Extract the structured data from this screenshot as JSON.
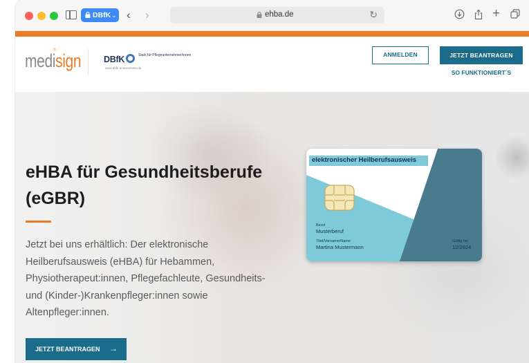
{
  "browser": {
    "tab_label": "DBfK",
    "url": "ehba.de"
  },
  "colors": {
    "accent": "#ec7b25",
    "primary": "#1b6c8a",
    "card_light": "#7ecad9",
    "card_dark": "#487b8e"
  },
  "header": {
    "logo_medisign_a": "medi",
    "logo_medisign_b": "sign",
    "logo_reg": "®",
    "dbfk_name": "DBfK",
    "dbfk_tagline": "Stark für Pflegeunternehmer/innen",
    "dbfk_url": "www.dbfk-unternehmer.de",
    "login_label": "ANMELDEN",
    "apply_label": "JETZT BEANTRAGEN",
    "how_label": "SO FUNKTIONIERT´S"
  },
  "hero": {
    "title": "eHBA für Gesundheitsberufe (eGBR)",
    "text": "Jetzt bei uns erhältlich: Der elektronische Heilberufsausweis (eHBA) für Hebammen, Physiotherapeut:innen, Pflegefachleute, Gesundheits- und (Kinder-)Krankenpfleger:innen sowie Altenpfleger:innen.",
    "cta_label": "JETZT BEANTRAGEN",
    "cta_arrow": "→"
  },
  "card": {
    "header": "elektronischer Heilberufsausweis",
    "beruf_label": "Beruf",
    "beruf_value": "Musterberuf",
    "name_label": "Titel/Vorname/Name",
    "name_value": "Martina Mustermann",
    "valid_label": "Gültig bis",
    "valid_value": "12/2024"
  }
}
